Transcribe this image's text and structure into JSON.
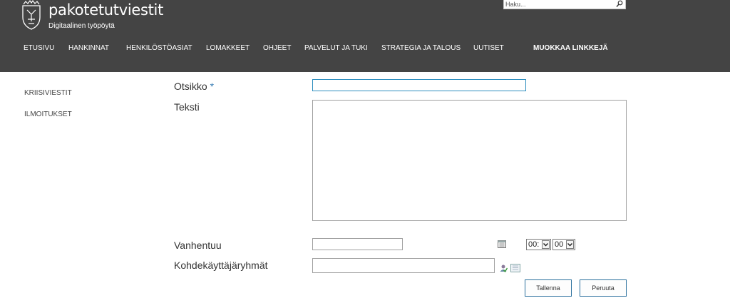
{
  "site": {
    "title": "pakotetutviestit",
    "subtitle": "Digitaalinen työpöytä"
  },
  "search": {
    "placeholder": "Haku...",
    "icon": "magnifier"
  },
  "nav": {
    "items": [
      "ETUSIVU",
      "HANKINNAT",
      "HENKILÖSTÖASIAT",
      "LOMAKKEET",
      "OHJEET",
      "PALVELUT JA TUKI",
      "STRATEGIA JA TALOUS",
      "UUTISET"
    ],
    "edit_links": "MUOKKAA LINKKEJÄ"
  },
  "quicklaunch": {
    "items": [
      "KRIISIVIESTIT",
      "ILMOITUKSET"
    ]
  },
  "form": {
    "title_label": "Otsikko",
    "required_marker": "*",
    "title_value": "",
    "text_label": "Teksti",
    "text_value": "",
    "expires_label": "Vanhentuu",
    "expires_date": "",
    "hour_value": "00:",
    "minute_value": "00",
    "target_groups_label": "Kohdekäyttäjäryhmät",
    "target_groups_value": ""
  },
  "buttons": {
    "save": "Tallenna",
    "cancel": "Peruuta"
  },
  "colors": {
    "header_bg": "#444444",
    "accent_border": "#2f8fbf"
  }
}
